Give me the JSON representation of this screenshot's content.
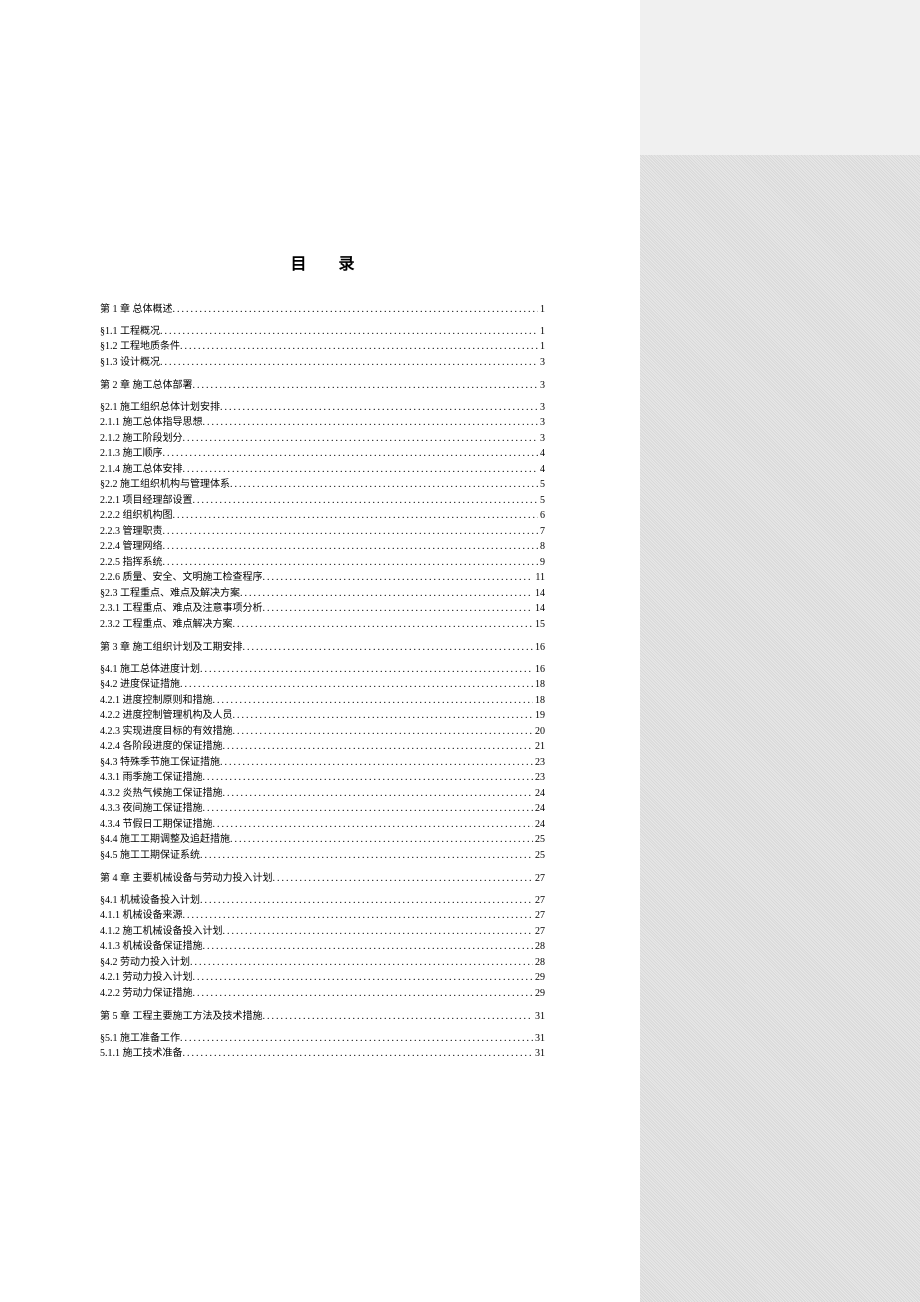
{
  "title": "目录",
  "entries": [
    {
      "level": "chapter",
      "label": "第 1 章  总体概述",
      "page": "1"
    },
    {
      "level": "section",
      "label": "§1.1 工程概况",
      "page": "1"
    },
    {
      "level": "section",
      "label": "§1.2 工程地质条件",
      "page": "1"
    },
    {
      "level": "section",
      "label": "§1.3 设计概况",
      "page": "3"
    },
    {
      "level": "chapter",
      "label": "第 2 章  施工总体部署",
      "page": "3"
    },
    {
      "level": "section",
      "label": "§2.1 施工组织总体计划安排",
      "page": "3"
    },
    {
      "level": "subsection",
      "label": "2.1.1 施工总体指导思想",
      "page": "3"
    },
    {
      "level": "subsection",
      "label": "2.1.2 施工阶段划分",
      "page": "3"
    },
    {
      "level": "subsection",
      "label": "2.1.3 施工顺序",
      "page": "4"
    },
    {
      "level": "subsection",
      "label": "2.1.4 施工总体安排",
      "page": "4"
    },
    {
      "level": "section",
      "label": "§2.2 施工组织机构与管理体系",
      "page": "5"
    },
    {
      "level": "subsection",
      "label": "2.2.1 项目经理部设置",
      "page": "5"
    },
    {
      "level": "subsection",
      "label": "2.2.2 组织机构图",
      "page": "6"
    },
    {
      "level": "subsection",
      "label": "2.2.3 管理职责",
      "page": "7"
    },
    {
      "level": "subsection",
      "label": "2.2.4 管理网络",
      "page": "8"
    },
    {
      "level": "subsection",
      "label": "2.2.5 指挥系统",
      "page": "9"
    },
    {
      "level": "subsection",
      "label": "2.2.6 质量、安全、文明施工检查程序",
      "page": "11"
    },
    {
      "level": "section",
      "label": "§2.3 工程重点、难点及解决方案",
      "page": "14"
    },
    {
      "level": "subsection",
      "label": "2.3.1 工程重点、难点及注意事项分析",
      "page": "14"
    },
    {
      "level": "subsection",
      "label": "2.3.2 工程重点、难点解决方案",
      "page": "15"
    },
    {
      "level": "chapter",
      "label": "第 3 章  施工组织计划及工期安排",
      "page": "16"
    },
    {
      "level": "section",
      "label": "§4.1 施工总体进度计划",
      "page": "16"
    },
    {
      "level": "section",
      "label": "§4.2 进度保证措施",
      "page": "18"
    },
    {
      "level": "subsection",
      "label": "4.2.1 进度控制原则和措施",
      "page": "18"
    },
    {
      "level": "subsection",
      "label": "4.2.2 进度控制管理机构及人员",
      "page": "19"
    },
    {
      "level": "subsection",
      "label": "4.2.3 实现进度目标的有效措施",
      "page": "20"
    },
    {
      "level": "subsection",
      "label": "4.2.4 各阶段进度的保证措施",
      "page": "21"
    },
    {
      "level": "section",
      "label": "§4.3 特殊季节施工保证措施",
      "page": "23"
    },
    {
      "level": "subsection",
      "label": "4.3.1 雨季施工保证措施",
      "page": "23"
    },
    {
      "level": "subsection",
      "label": "4.3.2 炎热气候施工保证措施",
      "page": "24"
    },
    {
      "level": "subsection",
      "label": "4.3.3 夜间施工保证措施",
      "page": "24"
    },
    {
      "level": "subsection",
      "label": "4.3.4 节假日工期保证措施",
      "page": "24"
    },
    {
      "level": "section",
      "label": "§4.4 施工工期调整及追赶措施",
      "page": "25"
    },
    {
      "level": "section",
      "label": "§4.5 施工工期保证系统",
      "page": "25"
    },
    {
      "level": "chapter",
      "label": "第 4 章  主要机械设备与劳动力投入计划",
      "page": "27"
    },
    {
      "level": "section",
      "label": "§4.1 机械设备投入计划",
      "page": "27"
    },
    {
      "level": "subsection",
      "label": "4.1.1 机械设备来源",
      "page": "27"
    },
    {
      "level": "subsection",
      "label": "4.1.2 施工机械设备投入计划",
      "page": "27"
    },
    {
      "level": "subsection",
      "label": "4.1.3 机械设备保证措施",
      "page": "28"
    },
    {
      "level": "section",
      "label": "§4.2 劳动力投入计划",
      "page": "28"
    },
    {
      "level": "subsection",
      "label": "4.2.1 劳动力投入计划",
      "page": "29"
    },
    {
      "level": "subsection",
      "label": "4.2.2 劳动力保证措施",
      "page": "29"
    },
    {
      "level": "chapter",
      "label": "第 5 章  工程主要施工方法及技术措施",
      "page": "31"
    },
    {
      "level": "section",
      "label": "§5.1 施工准备工作",
      "page": "31"
    },
    {
      "level": "subsection",
      "label": "5.1.1 施工技术准备",
      "page": "31"
    }
  ]
}
